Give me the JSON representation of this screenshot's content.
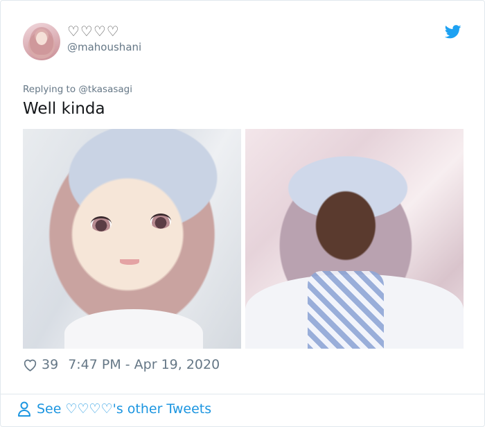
{
  "user": {
    "display_name": "♡♡♡♡",
    "handle": "@mahoushani"
  },
  "tweet": {
    "replying_prefix": "Replying to ",
    "replying_to": "@tkasasagi",
    "text": "Well kinda",
    "likes": "39",
    "timestamp": "7:47 PM - Apr 19, 2020"
  },
  "media": {
    "left_alt": "anime-style illustration",
    "right_alt": "cosplay photo"
  },
  "footer": {
    "link_text": "See ♡♡♡♡'s other Tweets"
  },
  "colors": {
    "twitter_blue": "#1da1f2",
    "link_blue": "#1b95e0",
    "secondary_text": "#657786"
  },
  "icons": [
    "twitter-bird-icon",
    "heart-icon",
    "person-icon"
  ]
}
